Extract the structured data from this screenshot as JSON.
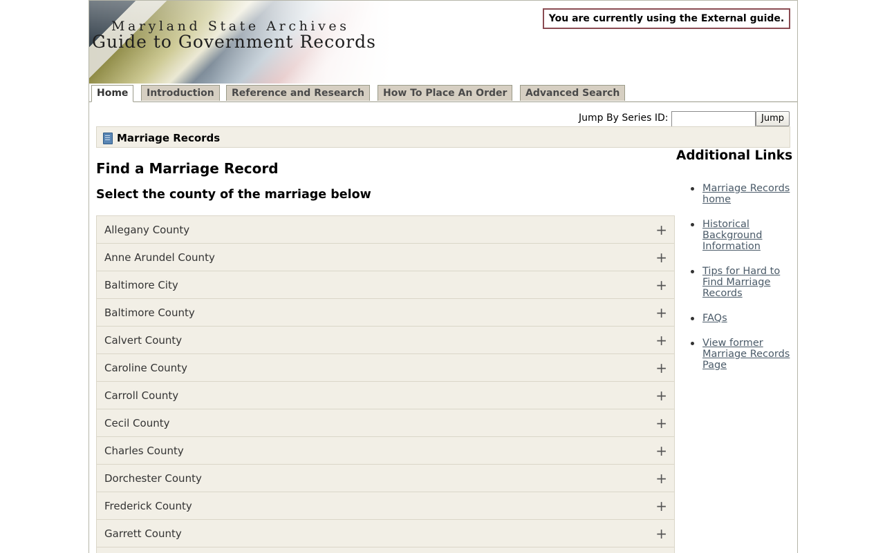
{
  "header": {
    "subtitle": "Maryland State Archives",
    "title": "Guide to Government Records",
    "guide_notice": "You are currently using the External guide."
  },
  "tabs": [
    {
      "label": "Home",
      "active": true
    },
    {
      "label": "Introduction",
      "active": false
    },
    {
      "label": "Reference and Research",
      "active": false
    },
    {
      "label": "How To Place An Order",
      "active": false
    },
    {
      "label": "Advanced Search",
      "active": false
    }
  ],
  "jump": {
    "label": "Jump By Series ID:",
    "value": "",
    "button": "Jump"
  },
  "breadcrumb": {
    "label": "Marriage Records",
    "icon": "book-icon"
  },
  "main": {
    "heading": "Find a Marriage Record",
    "subheading": "Select the county of the marriage below",
    "expand_symbol": "+",
    "counties": [
      "Allegany County",
      "Anne Arundel County",
      "Baltimore City",
      "Baltimore County",
      "Calvert County",
      "Caroline County",
      "Carroll County",
      "Cecil County",
      "Charles County",
      "Dorchester County",
      "Frederick County",
      "Garrett County"
    ]
  },
  "sidebar": {
    "title": "Additional Links",
    "links": [
      "Marriage Records home",
      "Historical Background Information",
      "Tips for Hard to Find Marriage Records",
      "FAQs",
      "View former Marriage Records Page"
    ]
  },
  "colors": {
    "tab_bg": "#d6cfc2",
    "panel_bg": "#f2efe6",
    "notice_border": "#8a4b52",
    "link": "#4a5a68"
  }
}
